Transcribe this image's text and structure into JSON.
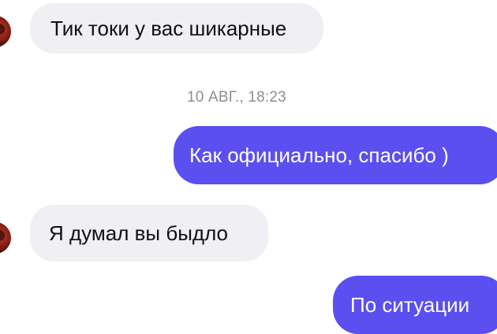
{
  "chat": {
    "messages": [
      {
        "direction": "incoming",
        "text": "Тик токи у вас шикарные"
      },
      {
        "direction": "outgoing",
        "text": "Как официально, спасибо )"
      },
      {
        "direction": "incoming",
        "text": "Я думал вы быдло"
      },
      {
        "direction": "outgoing",
        "text": "По ситуации"
      }
    ],
    "timestamp": "10 АВГ., 18:23"
  },
  "colors": {
    "outgoing_bubble": "#5b4ff0",
    "incoming_bubble": "#efeff4",
    "timestamp_text": "#8e8e93"
  }
}
